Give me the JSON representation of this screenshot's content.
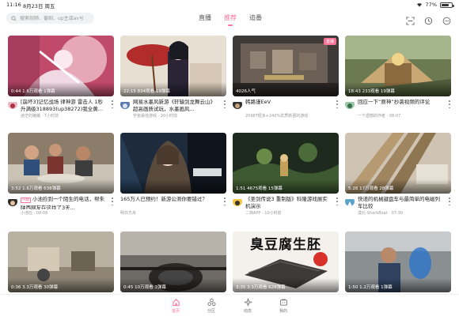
{
  "status": {
    "time": "11:16",
    "date": "8月23日 周五",
    "battery": "77%",
    "battery_level": 0.77
  },
  "search": {
    "placeholder": "搜索视频、番剧、up主或av号"
  },
  "tabs": [
    {
      "label": "直播"
    },
    {
      "label": "推荐"
    },
    {
      "label": "追番"
    }
  ],
  "active_tab": 1,
  "colors": {
    "accent": "#fb7299"
  },
  "cards": [
    {
      "stats": "0:44  1.6万观看  1弹幕",
      "title": "[崩坏3]记忆战场 律神游 雷击人 1秒升满级318893(up38272)我全黄...",
      "sub": "迷茫的猪猪 · 7小时前",
      "tag": "",
      "badge": ""
    },
    {
      "stats": "22:15  834观看  19弹幕",
      "title": "网易水墨风新游《轩辕剑龙舞云山》超高画质试玩，水墨画风...",
      "sub": "宇宙最佳游戏 · 20小时前",
      "tag": "",
      "badge": ""
    },
    {
      "stats": "4026人气",
      "title": "韩路谨EeV",
      "sub": "2098T很多+240%优质新晋的游戏",
      "tag": "",
      "badge": "直播"
    },
    {
      "stats": "18:43  233观看  19弹幕",
      "title": "回应一下“原神”抄袭视频的评论",
      "sub": "一个遗憾的作者 · 08-07",
      "tag": "",
      "badge": ""
    },
    {
      "stats": "3:52  1.6万观看  638弹幕",
      "title": "小池捡到一个陌生的电话，帮朱陕西网友在这找了3天...",
      "sub": "小池捡 · 08-08",
      "tag": "兴趣",
      "badge": ""
    },
    {
      "stats": "",
      "title": "165万人已预约！新游公测你要错过？",
      "sub": "明日方舟",
      "tag": "",
      "badge": ""
    },
    {
      "stats": "1:51  4675观看  15弹幕",
      "title": "《圣剑传说3 重制版》科隆游戏展实机演示",
      "sub": "二档APP · 10小时前",
      "tag": "",
      "badge": ""
    },
    {
      "stats": "5:26  17万观看  28弹幕",
      "title": "快递的机械键盘车与最简单的电磁列车比较",
      "sub": "漠北-SharkBoat · 07-30",
      "tag": "",
      "badge": ""
    },
    {
      "stats": "0:36  3.3万观看  30弹幕",
      "title": "",
      "sub": "",
      "tag": "",
      "badge": ""
    },
    {
      "stats": "0:45  10万观看  3弹幕",
      "title": "",
      "sub": "",
      "tag": "",
      "badge": ""
    },
    {
      "stats": "3:35  3.3万观看  628弹幕",
      "title": "",
      "sub": "",
      "tag": "",
      "badge": "",
      "overlay": "臭豆腐生胚"
    },
    {
      "stats": "1:50  1.2万观看  1弹幕",
      "title": "",
      "sub": "",
      "tag": "",
      "badge": ""
    }
  ],
  "bottom_nav": [
    {
      "label": "首页",
      "icon": "home-icon"
    },
    {
      "label": "分区",
      "icon": "category-icon"
    },
    {
      "label": "动态",
      "icon": "dynamic-icon"
    },
    {
      "label": "我的",
      "icon": "tv-icon"
    }
  ]
}
